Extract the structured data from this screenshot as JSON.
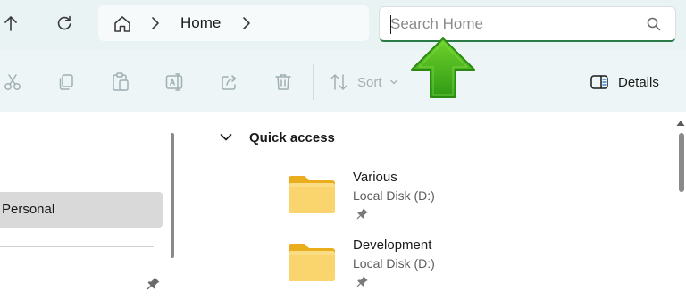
{
  "address_bar": {
    "breadcrumb": "Home"
  },
  "search": {
    "placeholder": "Search Home",
    "value": ""
  },
  "toolbar": {
    "sort_label": "Sort",
    "details_label": "Details"
  },
  "nav_pane": {
    "selected_item": "Personal"
  },
  "quick_access": {
    "title": "Quick access",
    "items": [
      {
        "name": "Various",
        "location": "Local Disk (D:)"
      },
      {
        "name": "Development",
        "location": "Local Disk (D:)"
      }
    ]
  },
  "colors": {
    "accent_green": "#2b7a45",
    "arrow_green": "#4cb31f",
    "folder_yellow": "#f7c948",
    "selected_bg": "#d9d9d9"
  },
  "icons": [
    "up-arrow-icon",
    "refresh-icon",
    "home-icon",
    "chevron-right-icon",
    "search-icon",
    "cut-icon",
    "copy-icon",
    "paste-icon",
    "rename-icon",
    "share-icon",
    "delete-icon",
    "sort-icon",
    "details-pane-icon",
    "pin-icon",
    "folder-icon",
    "chevron-down-icon"
  ]
}
